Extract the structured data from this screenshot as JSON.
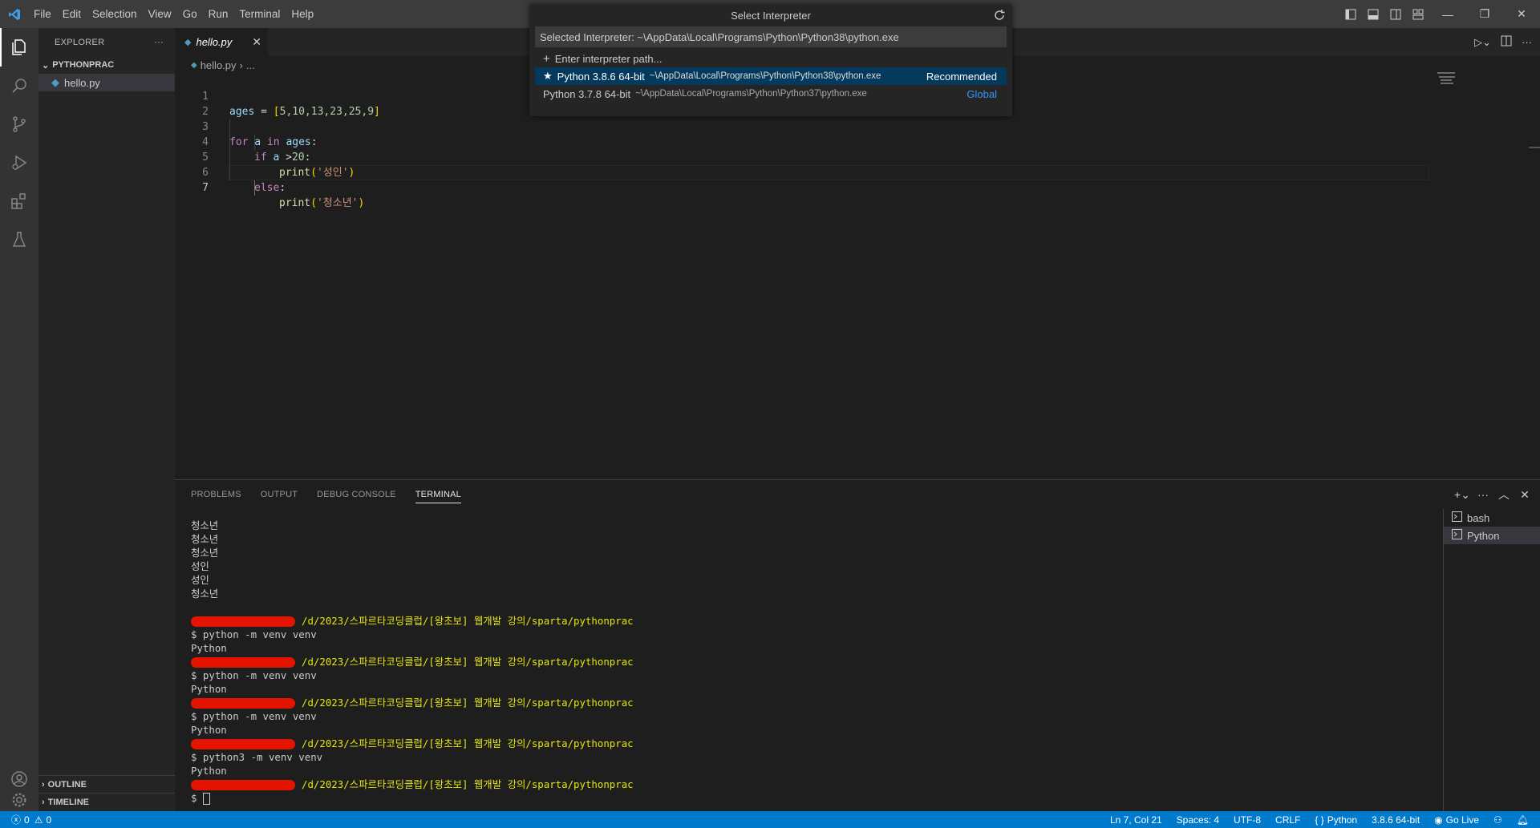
{
  "menu": [
    "File",
    "Edit",
    "Selection",
    "View",
    "Go",
    "Run",
    "Terminal",
    "Help"
  ],
  "sidebar": {
    "title": "EXPLORER",
    "more": "···",
    "folder": "PYTHONPRAC",
    "file": "hello.py",
    "outline": "OUTLINE",
    "timeline": "TIMELINE"
  },
  "editor": {
    "tab": "hello.py",
    "breadcrumb_file": "hello.py",
    "breadcrumb_rest": "...",
    "line_numbers": [
      "1",
      "2",
      "3",
      "4",
      "5",
      "6",
      "7"
    ],
    "code": {
      "l1_var": "ages",
      "l1_eq": " = ",
      "l1_open": "[",
      "l1_nums": "5,10,13,23,25,9",
      "l1_close": "]",
      "l3_for": "for",
      "l3_a": " a ",
      "l3_in": "in",
      "l3_ages": " ages",
      "l3_colon": ":",
      "l4_if": "if",
      "l4_a": " a ",
      "l4_op": ">",
      "l4_num": "20",
      "l4_colon": ":",
      "l5_fn": "print",
      "l5_str": "'성인'",
      "l6_else": "else",
      "l6_colon": ":",
      "l7_fn": "print",
      "l7_str": "'청소년'"
    }
  },
  "quickpick": {
    "title": "Select Interpreter",
    "input_value": "Selected Interpreter: ~\\AppData\\Local\\Programs\\Python\\Python38\\python.exe",
    "enter_path": "Enter interpreter path...",
    "items": [
      {
        "label": "Python 3.8.6 64-bit",
        "desc": "~\\AppData\\Local\\Programs\\Python\\Python38\\python.exe",
        "badge": "Recommended"
      },
      {
        "label": "Python 3.7.8 64-bit",
        "desc": "~\\AppData\\Local\\Programs\\Python\\Python37\\python.exe",
        "badge": "Global"
      }
    ]
  },
  "panel": {
    "tabs": [
      "PROBLEMS",
      "OUTPUT",
      "DEBUG CONSOLE",
      "TERMINAL"
    ],
    "terminals": [
      "bash",
      "Python"
    ]
  },
  "terminal": {
    "outputs": [
      "청소년",
      "청소년",
      "청소년",
      "성인",
      "성인",
      "청소년"
    ],
    "path": "/d/2023/스파르타코딩클럽/[왕초보] 웹개발 강의/sparta/pythonprac",
    "cmd1": "$ python -m venv venv",
    "cmd2": "$ python -m venv venv",
    "cmd3": "$ python -m venv venv",
    "cmd4": "$ python3 -m venv venv",
    "py": "Python",
    "prompt": "$ "
  },
  "status": {
    "errors": "0",
    "warnings": "0",
    "position": "Ln 7, Col 21",
    "spaces": "Spaces: 4",
    "encoding": "UTF-8",
    "eol": "CRLF",
    "language": "Python",
    "interpreter": "3.8.6 64-bit",
    "golive": "Go Live"
  },
  "colors": {
    "status_bar": "#007acc",
    "selection": "#04395e",
    "terminal_path": "#e5e510"
  }
}
